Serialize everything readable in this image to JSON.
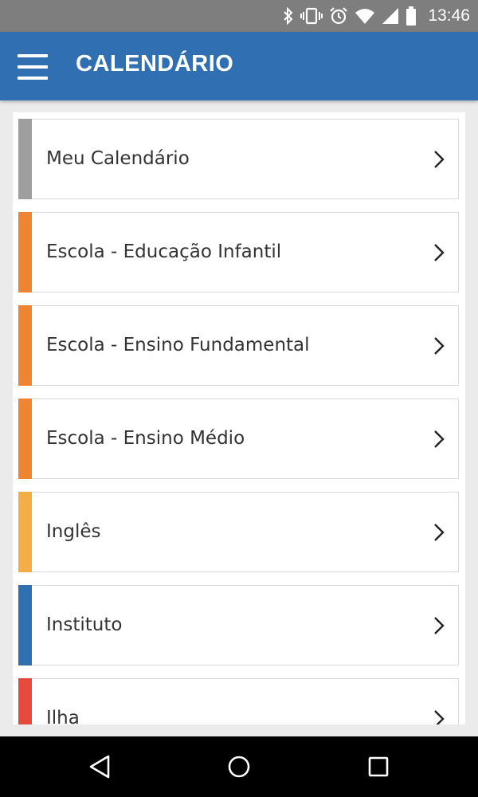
{
  "status_bar": {
    "time": "13:46",
    "icons": [
      "bluetooth-icon",
      "vibrate-icon",
      "alarm-icon",
      "wifi-icon",
      "signal-icon",
      "battery-icon"
    ]
  },
  "app_bar": {
    "title": "CALENDÁRIO",
    "menu_icon": "hamburger-menu-icon",
    "background": "#2f6fb2"
  },
  "calendar_items": [
    {
      "label": "Meu Calendário",
      "color": "#9e9e9e"
    },
    {
      "label": "Escola - Educação Infantil",
      "color": "#ef8532"
    },
    {
      "label": "Escola - Ensino Fundamental",
      "color": "#ef8532"
    },
    {
      "label": "Escola - Ensino Médio",
      "color": "#ef8532"
    },
    {
      "label": "Inglês",
      "color": "#f5ae45"
    },
    {
      "label": "Instituto",
      "color": "#2f6fb2"
    },
    {
      "label": "Ilha",
      "color": "#e64a3b"
    }
  ],
  "nav_bar": {
    "buttons": [
      "back-icon",
      "home-icon",
      "recents-icon"
    ]
  }
}
